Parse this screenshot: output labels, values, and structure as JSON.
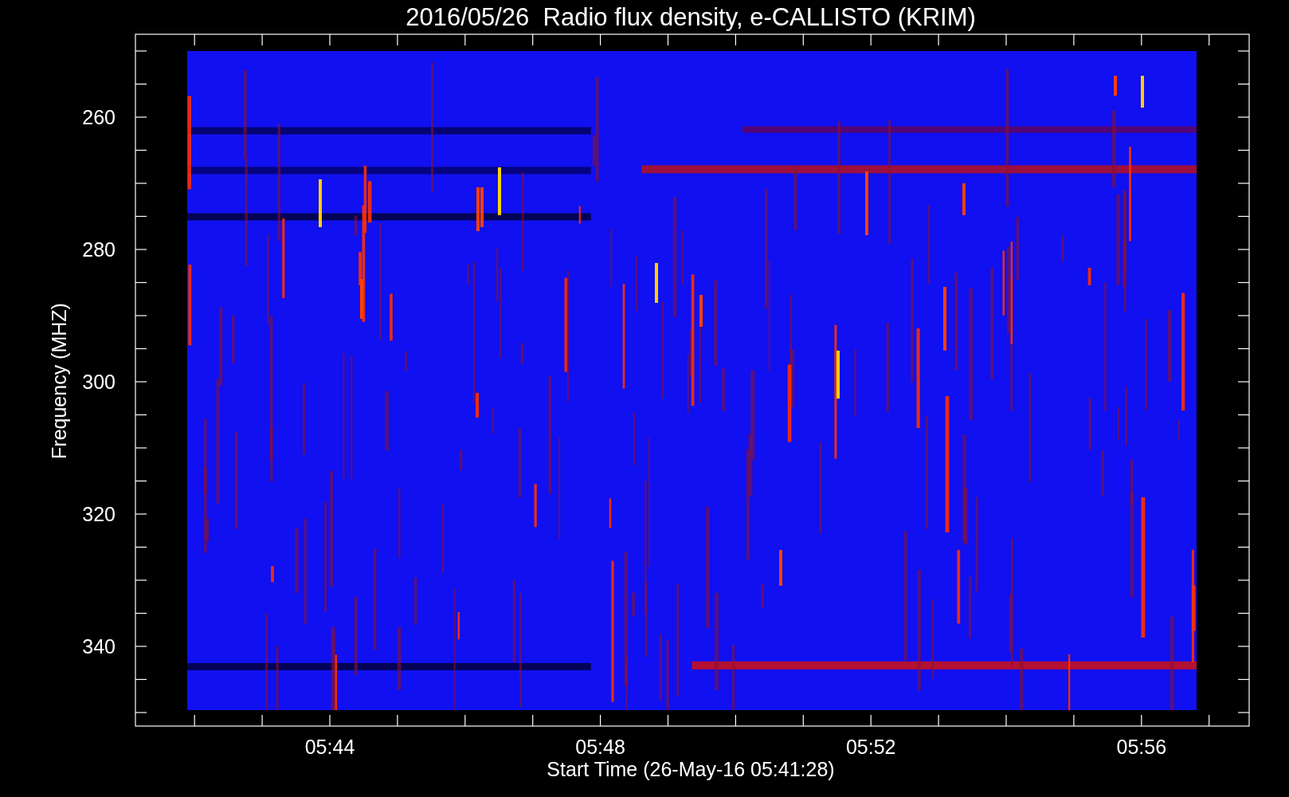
{
  "plot": {
    "title": "2016/05/26  Radio flux density, e-CALLISTO (KRIM)",
    "ylabel": "Frequency (MHZ)",
    "xlabel": "Start Time (26-May-16 05:41:28)",
    "yticks": [
      "260",
      "280",
      "300",
      "320",
      "340"
    ],
    "xticks": [
      "05:44",
      "05:48",
      "05:52",
      "05:56"
    ]
  }
}
